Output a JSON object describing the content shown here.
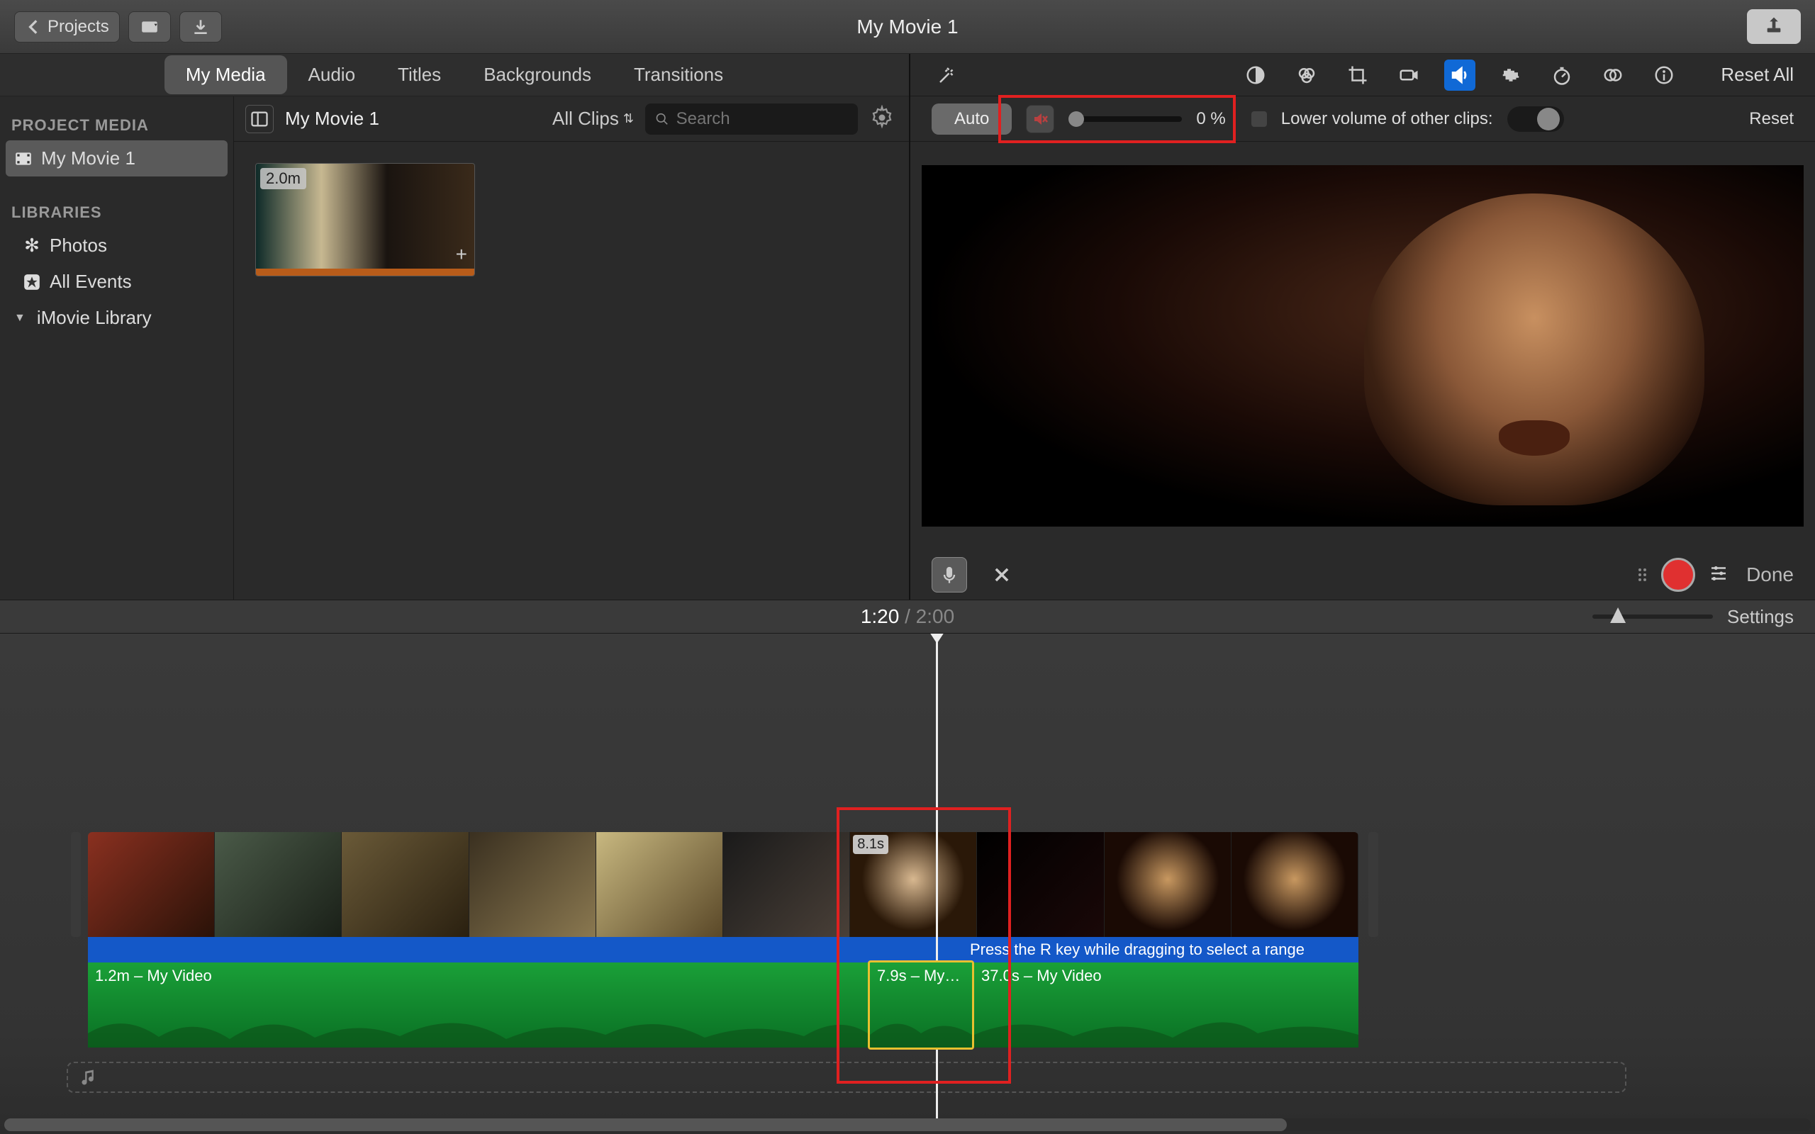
{
  "titlebar": {
    "back_label": "Projects",
    "window_title": "My Movie 1"
  },
  "tabs": {
    "my_media": "My Media",
    "audio": "Audio",
    "titles": "Titles",
    "backgrounds": "Backgrounds",
    "transitions": "Transitions"
  },
  "sidebar": {
    "project_media_header": "PROJECT MEDIA",
    "project_name": "My Movie 1",
    "libraries_header": "LIBRARIES",
    "photos": "Photos",
    "all_events": "All Events",
    "imovie_library": "iMovie Library"
  },
  "browser": {
    "title": "My Movie 1",
    "clips_filter": "All Clips",
    "search_placeholder": "Search",
    "clip": {
      "duration": "2.0m"
    }
  },
  "inspector": {
    "reset_all": "Reset All",
    "auto": "Auto",
    "volume_value": "0 %",
    "lower_volume_label": "Lower volume of other clips:",
    "reset": "Reset"
  },
  "preview_controls": {
    "done": "Done"
  },
  "timeline": {
    "current": "1:20",
    "total": "2:00",
    "settings": "Settings",
    "selected_clip_dur": "8.1s",
    "hint": "Press the R key while dragging to select a range",
    "audio": {
      "seg1": "1.2m – My Video",
      "seg2": "7.9s – My…",
      "seg3": "37.0s – My Video"
    }
  }
}
